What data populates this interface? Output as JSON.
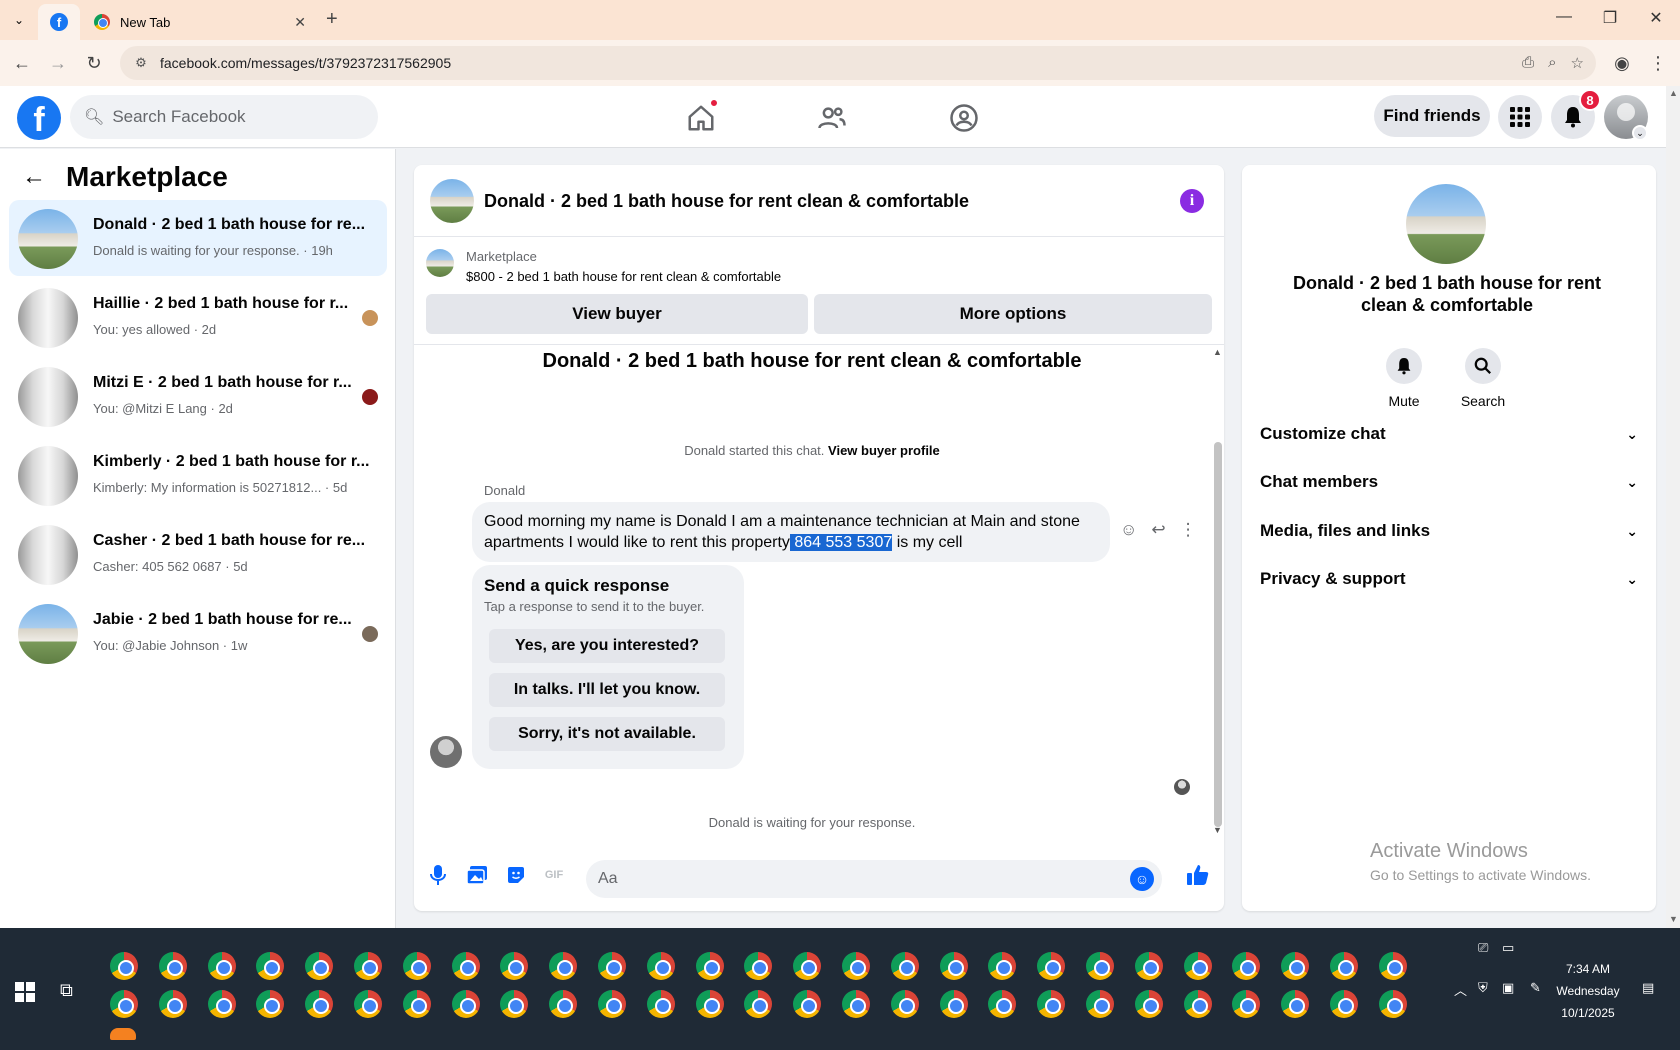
{
  "browser": {
    "tabs": [
      {
        "label": "",
        "icon": "facebook-icon",
        "active": true
      },
      {
        "label": "New Tab",
        "icon": "chrome-icon",
        "active": false
      }
    ],
    "url": "facebook.com/messages/t/3792372317562905"
  },
  "header": {
    "search_placeholder": "Search Facebook",
    "find_friends_label": "Find friends",
    "notification_count": "8"
  },
  "sidebar": {
    "title": "Marketplace",
    "conversations": [
      {
        "name": "Donald · 2 bed 1 bath house for re...",
        "preview": "Donald is waiting for your response. · 19h",
        "thumb": "house",
        "active": true
      },
      {
        "name": "Haillie · 2 bed 1 bath house for r...",
        "preview": "You: yes allowed · 2d",
        "thumb": "interior",
        "mini_color": "#c8935a"
      },
      {
        "name": "Mitzi E · 2 bed 1 bath house for r...",
        "preview": "You: @Mitzi E Lang · 2d",
        "thumb": "interior",
        "mini_color": "#8b1a1a"
      },
      {
        "name": "Kimberly · 2 bed 1 bath house for r...",
        "preview": "Kimberly: My information is 50271812... · 5d",
        "thumb": "interior"
      },
      {
        "name": "Casher · 2 bed 1 bath house for re...",
        "preview": "Casher: 405 562 0687 · 5d",
        "thumb": "interior"
      },
      {
        "name": "Jabie · 2 bed 1 bath house for re...",
        "preview": "You: @Jabie Johnson · 1w",
        "thumb": "house",
        "mini_color": "#7a6a5a"
      }
    ]
  },
  "chat": {
    "title": "Donald · 2 bed 1 bath house for rent clean & comfortable",
    "listing_label": "Marketplace",
    "listing_price": "$800 - 2 bed 1 bath house for rent clean & comfortable",
    "view_buyer_label": "View buyer",
    "more_options_label": "More options",
    "conversation_title": "Donald · 2 bed 1 bath house for rent clean & comfortable",
    "started_text": "Donald started this chat.",
    "view_profile_label": "View buyer profile",
    "sender": "Donald",
    "message_pre": "Good morning my name is Donald I am a maintenance technician at Main and stone apartments I would like to rent this property",
    "message_highlight": " 864 553 5307",
    "message_post": " is my cell",
    "quick_title": "Send a quick response",
    "quick_subtitle": "Tap a response to send it to the buyer.",
    "quick_responses": [
      "Yes, are you interested?",
      "In talks. I'll let you know.",
      "Sorry, it's not available."
    ],
    "waiting_text": "Donald is waiting for your response.",
    "composer_placeholder": "Aa"
  },
  "details": {
    "title": "Donald · 2 bed 1 bath house for rent clean & comfortable",
    "actions": [
      {
        "label": "Mute",
        "icon": "bell-icon"
      },
      {
        "label": "Search",
        "icon": "search-icon"
      }
    ],
    "sections": [
      "Customize chat",
      "Chat members",
      "Media, files and links",
      "Privacy & support"
    ],
    "watermark_title": "Activate Windows",
    "watermark_sub": "Go to Settings to activate Windows."
  },
  "taskbar": {
    "time": "7:34 AM",
    "day": "Wednesday",
    "date": "10/1/2025",
    "chrome_row1_count": 27,
    "chrome_row2_count": 27
  }
}
